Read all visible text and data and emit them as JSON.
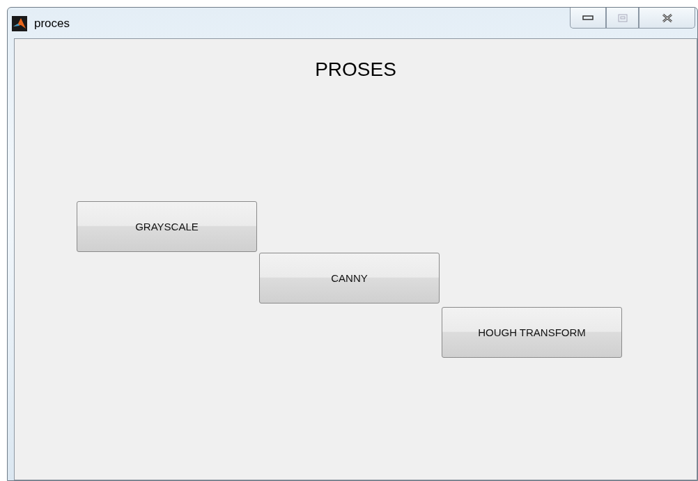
{
  "window": {
    "title": "proces"
  },
  "heading": "PROSES",
  "buttons": [
    {
      "label": "GRAYSCALE"
    },
    {
      "label": "CANNY"
    },
    {
      "label": "HOUGH TRANSFORM"
    }
  ]
}
